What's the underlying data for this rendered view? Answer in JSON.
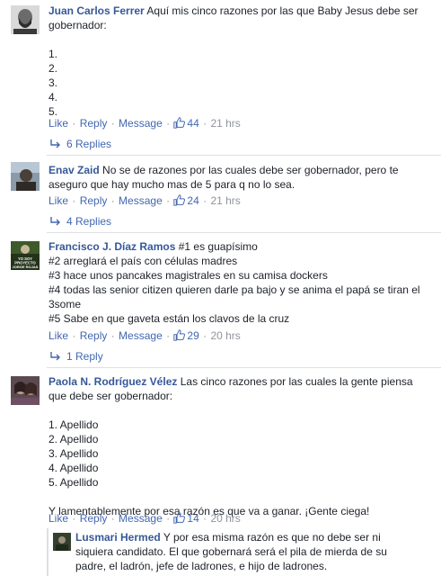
{
  "colors": {
    "name": "#365899",
    "link": "#4267b2",
    "meta": "#90949c",
    "text": "#1d2129"
  },
  "comments": [
    {
      "author": "Juan Carlos Ferrer",
      "lines": [
        "Aquí mis cinco razones por las que Baby Jesus debe ser",
        "gobernador:",
        "",
        "1.",
        "2.",
        "3.",
        "4.",
        "5."
      ],
      "like": "Like",
      "reply": "Reply",
      "message": "Message",
      "likes": "44",
      "time": "21 hrs",
      "replies": "6 Replies"
    },
    {
      "author": "Enav Zaid",
      "lines": [
        "No se de razones por las cuales debe ser gobernador, pero te",
        "aseguro que hay mucho mas de 5 para q no lo sea."
      ],
      "like": "Like",
      "reply": "Reply",
      "message": "Message",
      "likes": "24",
      "time": "21 hrs",
      "replies": "4 Replies"
    },
    {
      "author": "Francisco J. Díaz Ramos",
      "avatar_text": "YO SOY PROYECTO JORGE ROJAS",
      "lines": [
        "#1 es guapísimo",
        "#2 arreglará el país con células madres",
        "#3 hace unos pancakes magistrales en su camisa dockers",
        "#4 todas las senior citizen quieren darle pa bajo y se anima el papá se tiran el",
        "3some",
        "#5 Sabe en que gaveta están los clavos de la cruz"
      ],
      "like": "Like",
      "reply": "Reply",
      "message": "Message",
      "likes": "29",
      "time": "20 hrs",
      "replies": "1 Reply"
    },
    {
      "author": "Paola N. Rodríguez Vélez",
      "lines": [
        "Las cinco razones por las cuales la gente piensa",
        "que debe ser gobernador:",
        "",
        "1. Apellido",
        "2. Apellido",
        "3. Apellido",
        "4. Apellido",
        "5. Apellido",
        "",
        "Y lamentablemente por esa razón es que va a ganar. ¡Gente ciega!"
      ],
      "like": "Like",
      "reply": "Reply",
      "message": "Message",
      "likes": "14",
      "time": "20 hrs"
    },
    {
      "author": "Lusmari Hermed",
      "lines": [
        "Y por esa misma razón es que no debe ser ni",
        "siquiera candidato. El que gobernará será el pila de mierda de su",
        "padre, el ladrón, jefe de ladrones, e hijo de ladrones."
      ]
    }
  ]
}
